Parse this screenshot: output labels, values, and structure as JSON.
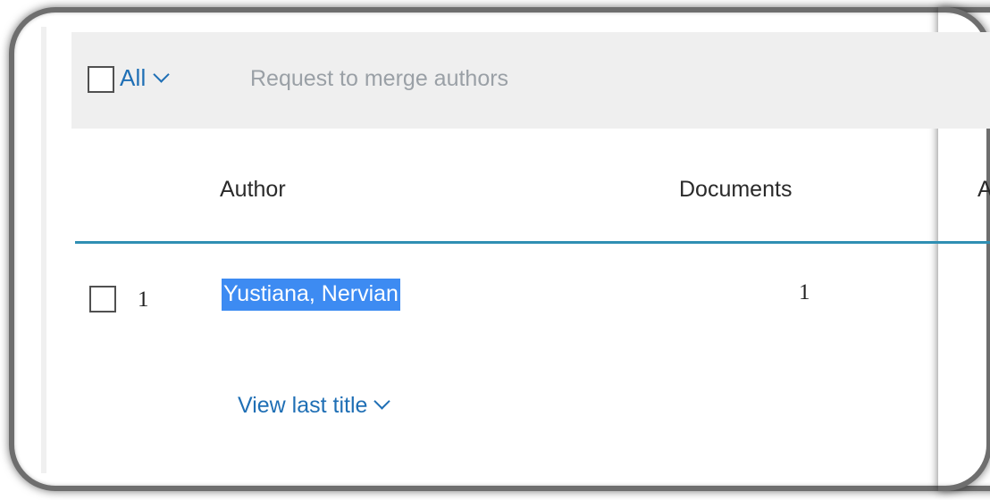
{
  "toolbar": {
    "all_label": "All",
    "merge_label": "Request to merge authors"
  },
  "table": {
    "columns": [
      "Author",
      "Documents"
    ],
    "cut_column_glyph": "A",
    "rows": [
      {
        "index": "1",
        "author": "Yustiana, Nervian",
        "documents": "1",
        "view_last_title": "View last title"
      }
    ]
  },
  "colors": {
    "link": "#1f6fb5",
    "disabled": "#9aa0a6",
    "header_rule": "#2f8fb3",
    "selection": "#3d8bf2",
    "toolbar_bg": "#efefef"
  }
}
